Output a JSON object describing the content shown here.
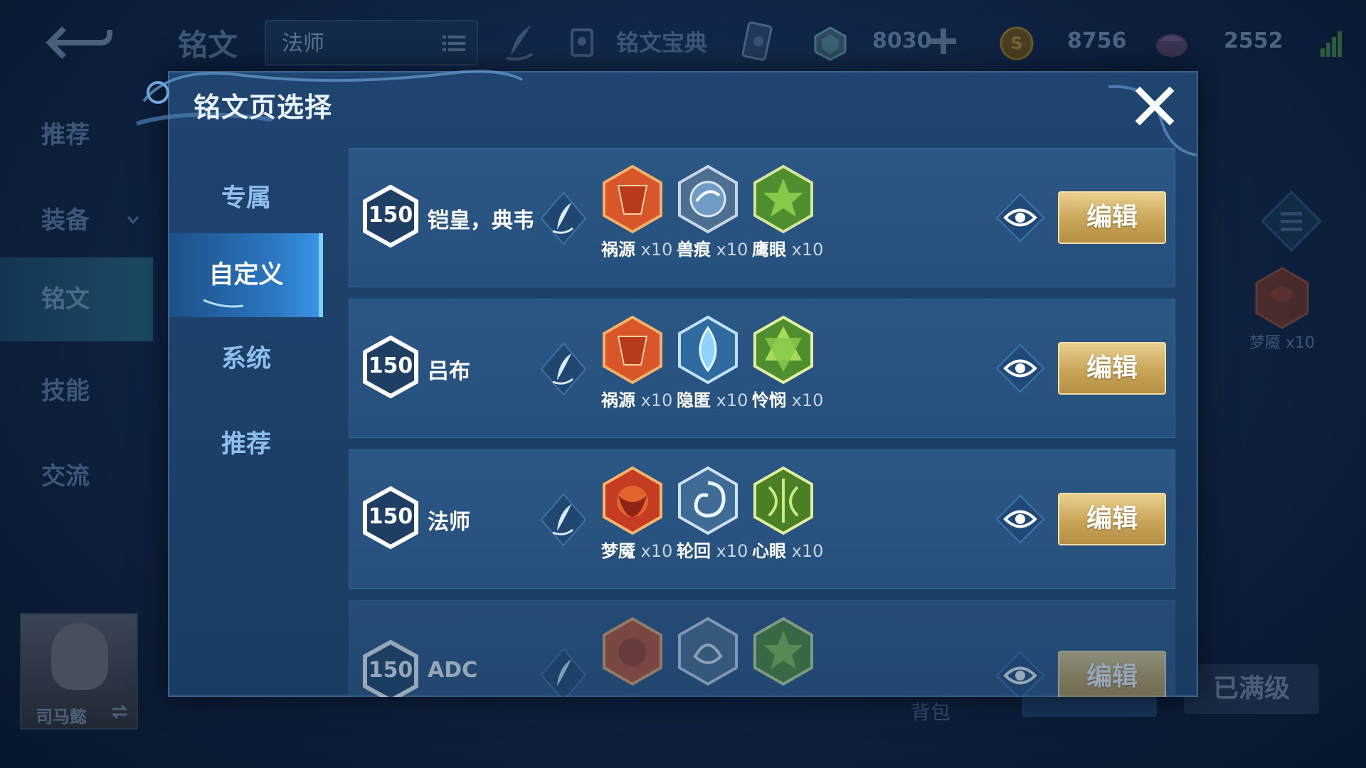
{
  "background": {
    "page_title": "铭文",
    "page_selector_value": "法师",
    "codex_label": "铭文宝典",
    "currencies": [
      {
        "name": "diamond",
        "value": "8030"
      },
      {
        "name": "gold-coin",
        "value": "8756"
      },
      {
        "name": "gem",
        "value": "2552"
      }
    ],
    "side_nav": [
      {
        "label": "推荐"
      },
      {
        "label": "装备"
      },
      {
        "label": "铭文"
      },
      {
        "label": "技能"
      },
      {
        "label": "交流"
      }
    ],
    "hero_name": "司马懿",
    "bag_label": "背包",
    "maxed_label": "已满级",
    "right_rune_label": "梦魇 x10"
  },
  "modal": {
    "title": "铭文页选择",
    "tabs": [
      {
        "label": "专属",
        "active": false
      },
      {
        "label": "自定义",
        "active": true
      },
      {
        "label": "系统",
        "active": false
      },
      {
        "label": "推荐",
        "active": false
      }
    ],
    "pages": [
      {
        "level": "150",
        "name": "铠皇，典韦",
        "runes": [
          {
            "name": "祸源",
            "count": "x10",
            "color": "#d9552a"
          },
          {
            "name": "兽痕",
            "count": "x10",
            "color": "#6f9cc4"
          },
          {
            "name": "鹰眼",
            "count": "x10",
            "color": "#5ea63a"
          }
        ],
        "edit_label": "编辑"
      },
      {
        "level": "150",
        "name": "吕布",
        "runes": [
          {
            "name": "祸源",
            "count": "x10",
            "color": "#d9552a"
          },
          {
            "name": "隐匿",
            "count": "x10",
            "color": "#4ea2dc"
          },
          {
            "name": "怜悯",
            "count": "x10",
            "color": "#72b83e"
          }
        ],
        "edit_label": "编辑"
      },
      {
        "level": "150",
        "name": "法师",
        "runes": [
          {
            "name": "梦魇",
            "count": "x10",
            "color": "#d0442a"
          },
          {
            "name": "轮回",
            "count": "x10",
            "color": "#4c8fc6"
          },
          {
            "name": "心眼",
            "count": "x10",
            "color": "#5e9e32"
          }
        ],
        "edit_label": "编辑"
      },
      {
        "level": "150",
        "name": "ADC",
        "runes": [
          {
            "name": "",
            "count": "",
            "color": "#c8502a"
          },
          {
            "name": "",
            "count": "",
            "color": "#5a88b4"
          },
          {
            "name": "",
            "count": "",
            "color": "#5ea63a"
          }
        ],
        "edit_label": "编辑"
      }
    ]
  }
}
